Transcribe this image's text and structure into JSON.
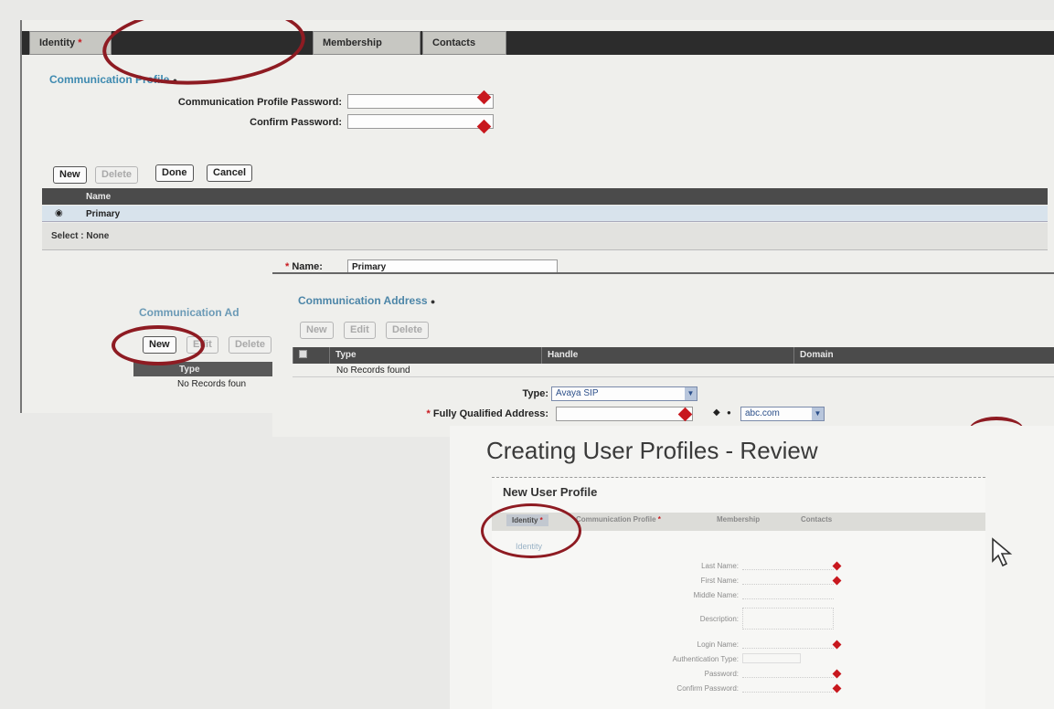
{
  "back_panel": {
    "tabs": [
      "Identity",
      "Membership",
      "Contacts"
    ],
    "section_title": "Communication Profile",
    "fields": {
      "password_label": "Communication Profile Password:",
      "confirm_label": "Confirm Password:"
    },
    "buttons": [
      "New",
      "Delete",
      "Done",
      "Cancel"
    ],
    "grid": {
      "header": "Name",
      "row": "Primary",
      "select_text": "Select : None"
    },
    "name_field": {
      "label": "Name:",
      "value": "Primary"
    },
    "comm_address": {
      "title": "Communication Ad",
      "buttons": [
        "New",
        "Edit",
        "Delete"
      ],
      "header": "Type",
      "empty": "No Records foun"
    }
  },
  "mid_panel": {
    "title": "Communication Address",
    "buttons": [
      "New",
      "Edit",
      "Delete"
    ],
    "columns": [
      "Type",
      "Handle",
      "Domain"
    ],
    "empty": "No Records found",
    "type_label": "Type:",
    "type_value": "Avaya SIP",
    "fqa_label": "Fully Qualified Address:",
    "domain_value": "abc.com"
  },
  "front_panel": {
    "title": "Creating User Profiles - Review",
    "card_title": "New User Profile",
    "tabs": [
      "Identity",
      "Communication Profile",
      "Membership",
      "Contacts"
    ],
    "identity_subtab": "Identity",
    "fields": [
      "Last Name:",
      "First Name:",
      "Middle Name:",
      "Description:",
      "Login Name:",
      "Authentication Type:",
      "Password:",
      "Confirm Password:"
    ]
  },
  "colors": {
    "annotation_circle": "#8e1b22",
    "required_marker": "#c8181e",
    "section_title": "#3e8ab0",
    "dark_bar": "#2c2c2c"
  }
}
